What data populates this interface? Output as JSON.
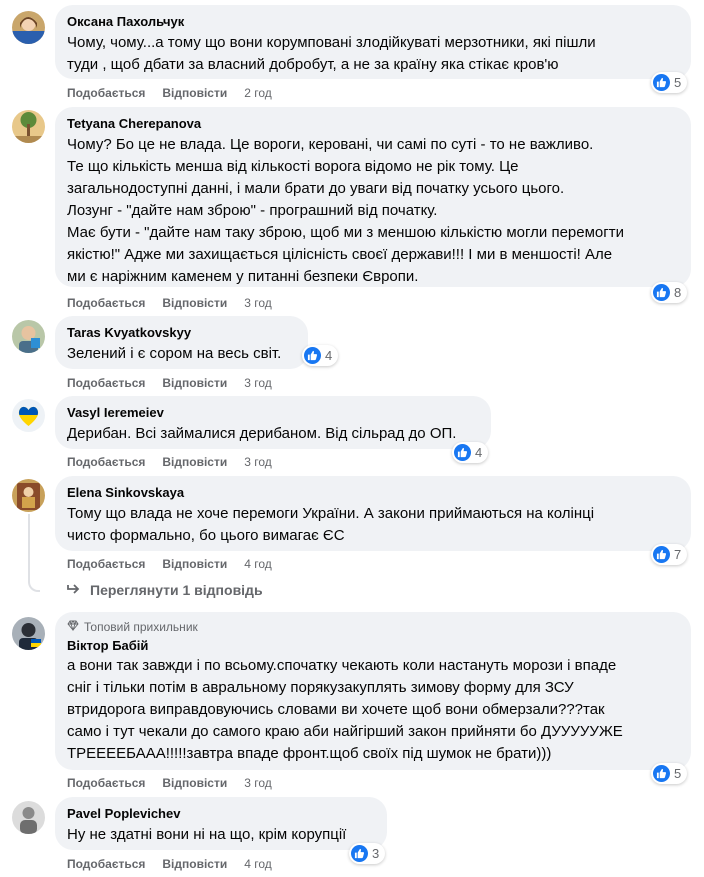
{
  "labels": {
    "like": "Подобається",
    "reply": "Відповісти"
  },
  "comments": [
    {
      "author": "Оксана Пахольчук",
      "lines": [
        "Чому, чому...а тому що вони корумповані злодійкуваті мерзотники, які пішли",
        "туди , щоб дбати за власний добробут, а не за країну яка стікає кров'ю"
      ],
      "time": "2 год",
      "reactions": "5"
    },
    {
      "author": "Tetyana Cherepanova",
      "lines": [
        "Чому? Бо це не влада. Це вороги, керовані, чи самі по суті - то не важливо.",
        "Те що кількість менша від кількості ворога відомо не рік тому. Це",
        "загальнодоступні данні, і мали брати до уваги від початку усього цього.",
        "Лозунг - \"дайте нам зброю\" - програшний від початку.",
        "Має бути - \"дайте нам таку зброю, щоб ми з меншою кількістю могли перемогти",
        "якістю!\" Адже ми захищається цілісність своєї держави!!! І ми в меншості! Але",
        "ми є наріжним каменем у питанні безпеки Європи."
      ],
      "time": "3 год",
      "reactions": "8"
    },
    {
      "author": "Taras Kvyatkovskyy",
      "lines": [
        "Зелений і є сором на весь світ."
      ],
      "time": "3 год",
      "reactions": "4"
    },
    {
      "author": "Vasyl Ieremeiev",
      "lines": [
        "Дерибан. Всі займалися дерибаном. Від сільрад до ОП."
      ],
      "time": "3 год",
      "reactions": "4"
    },
    {
      "author": "Elena Sinkovskaya",
      "lines": [
        "Тому що влада не хоче перемоги України. А закони приймаються на колінці",
        "чисто формально, бо цього вимагає ЄС"
      ],
      "time": "4 год",
      "reactions": "7"
    },
    {
      "badge": "Топовий прихильник",
      "author": "Віктор Бабій",
      "lines": [
        "а вони так завжди і по всьому.спочатку чекають коли настануть морози і впаде",
        "сніг і тільки потім в авральному порякузакуплять зимову форму для ЗСУ",
        "втридорога виправдовуючись словами ви хочете щоб вони обмерзали???так",
        "само і тут чекали до самого краю аби найгірший закон прийняти бо ДУУУУУЖЕ",
        "ТРЕЕЕЕБААА!!!!!завтра впаде фронт.щоб своїх під шумок не брати)))"
      ],
      "time": "3 год",
      "reactions": "5"
    },
    {
      "author": "Pavel Poplevichev",
      "lines": [
        "Ну не здатні вони ні на що, крім корупції"
      ],
      "time": "4 год",
      "reactions": "3"
    }
  ],
  "view_replies": "Переглянути 1 відповідь",
  "colors": {
    "bubble": "#f0f2f5",
    "like_blue": "#1877f2",
    "meta_gray": "#65676b"
  }
}
